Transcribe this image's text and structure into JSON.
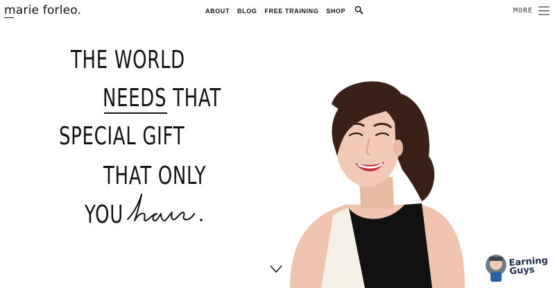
{
  "header": {
    "logo": "marie forleo.",
    "nav": [
      "ABOUT",
      "BLOG",
      "FREE TRAINING",
      "SHOP"
    ],
    "more_label": "MORE"
  },
  "hero": {
    "lines": [
      "THE WORLD",
      "THAT",
      "SPECIAL GIFT",
      "THAT ONLY",
      "YOU"
    ],
    "underlined_word": "NEEDS",
    "script_word": "have.",
    "image": "portrait of smiling woman in black and white sleeveless top"
  },
  "badge": {
    "line1": "Earning",
    "line2": "Guys"
  },
  "colors": {
    "text": "#111111",
    "background": "#ffffff",
    "hair": "#3a2016",
    "skin": "#f1c9b4",
    "lips": "#c8263a",
    "dress_black": "#111111",
    "dress_white": "#f5f0e6",
    "badge_navy": "#1c2c4a"
  }
}
